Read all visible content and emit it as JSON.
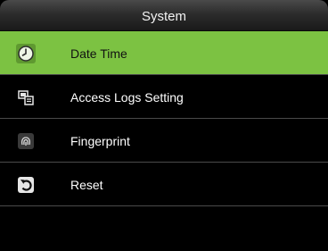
{
  "header": {
    "title": "System"
  },
  "menu": {
    "items": [
      {
        "label": "Date Time",
        "icon": "clock-icon",
        "selected": true
      },
      {
        "label": "Access Logs Setting",
        "icon": "logs-settings-icon",
        "selected": false
      },
      {
        "label": "Fingerprint",
        "icon": "fingerprint-icon",
        "selected": false
      },
      {
        "label": "Reset",
        "icon": "reset-icon",
        "selected": false
      }
    ]
  },
  "colors": {
    "accent": "#7cc242",
    "background": "#000000",
    "text": "#ffffff"
  }
}
